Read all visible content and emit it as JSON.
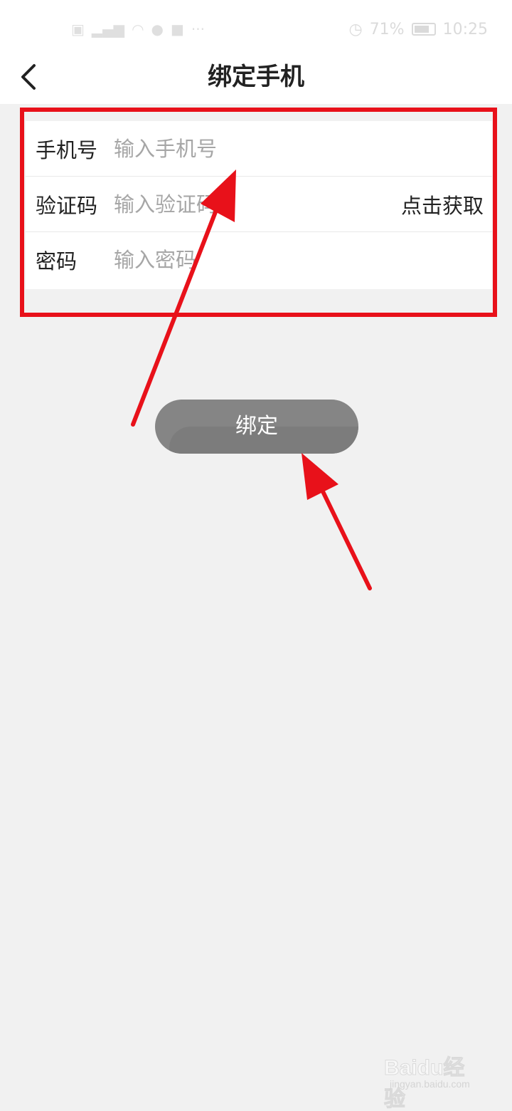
{
  "status_bar": {
    "battery": "71%",
    "time": "10:25"
  },
  "header": {
    "title": "绑定手机",
    "back_icon": "chevron-left-icon"
  },
  "form": {
    "phone": {
      "label": "手机号",
      "placeholder": "输入手机号"
    },
    "code": {
      "label": "验证码",
      "placeholder": "输入验证码",
      "action": "点击获取"
    },
    "password": {
      "label": "密码",
      "placeholder": "输入密码"
    }
  },
  "bind_button": {
    "label": "绑定"
  },
  "annotation": {
    "color": "#e8111a"
  },
  "watermark": {
    "brand": "Baidu经验",
    "sub": "jingyan.baidu.com"
  }
}
